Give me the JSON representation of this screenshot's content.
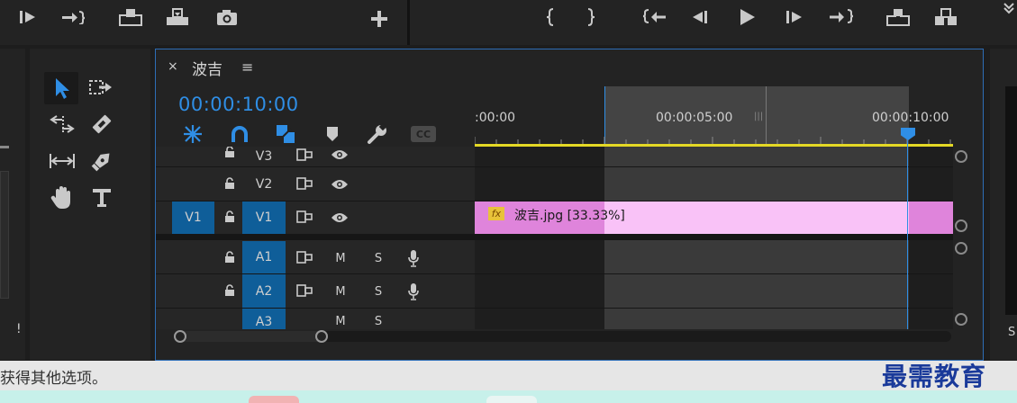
{
  "top_toolbar": {
    "left_icons": [
      "mark-in-icon",
      "step-forward-to-out-icon",
      "insert-icon",
      "overwrite-icon",
      "export-frame-icon",
      "add-button-icon"
    ],
    "right_icons": [
      "mark-in-brace-icon",
      "mark-out-brace-icon",
      "go-to-in-icon",
      "step-back-icon",
      "play-icon",
      "step-forward-icon",
      "go-to-out-icon",
      "lift-icon",
      "extract-icon"
    ]
  },
  "tools": [
    "selection-tool-icon",
    "track-select-forward-icon",
    "ripple-edit-icon",
    "razor-icon",
    "slip-icon",
    "pen-icon",
    "hand-icon",
    "type-icon"
  ],
  "timeline": {
    "close_label": "×",
    "sequence_name": "波吉",
    "menu_icon": "≡",
    "timecode": "00:00:10:00",
    "ruler": {
      "start": ":00:00",
      "mid": "00:00:05:00",
      "end": "00:00:10:00"
    },
    "header_buttons": [
      "nest-toggle-icon",
      "snap-magnet-icon",
      "linked-selection-icon",
      "add-marker-icon",
      "settings-wrench-icon",
      "captions-icon"
    ],
    "cc_label": "CC",
    "video_tracks": [
      {
        "name": "V3",
        "source": "",
        "targeted": false
      },
      {
        "name": "V2",
        "source": "",
        "targeted": false
      },
      {
        "name": "V1",
        "source": "V1",
        "targeted": true
      }
    ],
    "audio_tracks": [
      {
        "name": "A1",
        "m": "M",
        "s": "S"
      },
      {
        "name": "A2",
        "m": "M",
        "s": "S"
      },
      {
        "name": "A3",
        "m": "M",
        "s": "S"
      }
    ],
    "clip": {
      "fx": "fx",
      "label": "波吉.jpg [33.33%]",
      "color": "#f7b9f5"
    },
    "playhead_color": "#2f8ee5",
    "work_area_color": "#e4d825"
  },
  "right_panel": {
    "label": "S"
  },
  "left_panel": {
    "label": "!"
  },
  "status": {
    "text": "获得其他选项。"
  },
  "watermark": {
    "text": "最需教育"
  }
}
